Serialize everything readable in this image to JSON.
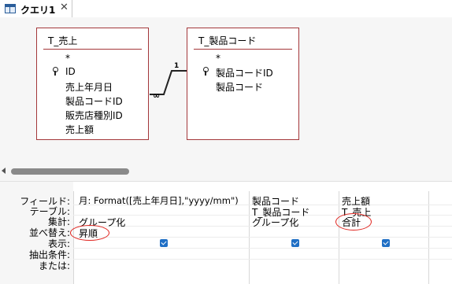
{
  "tab": {
    "label": "クエリ1",
    "close": "✕"
  },
  "tables": [
    {
      "title": "T_売上",
      "fields": [
        "*",
        "ID",
        "売上年月日",
        "製品コードID",
        "販売店種別ID",
        "売上額"
      ]
    },
    {
      "title": "T_製品コード",
      "fields": [
        "*",
        "製品コードID",
        "製品コード"
      ]
    }
  ],
  "relationship": {
    "one": "1",
    "many": "∞"
  },
  "grid": {
    "row_labels": [
      "フィールド:",
      "テーブル:",
      "集計:",
      "並べ替え:",
      "表示:",
      "抽出条件:",
      "または:"
    ],
    "columns": [
      {
        "field": "月: Format([売上年月日],\"yyyy/mm\")",
        "table": "",
        "total": "グループ化",
        "sort": "昇順",
        "show": true
      },
      {
        "field": "製品コード",
        "table": "T_製品コード",
        "total": "グループ化",
        "sort": "",
        "show": true
      },
      {
        "field": "売上額",
        "table": "T_売上",
        "total": "合計",
        "sort": "",
        "show": true
      }
    ]
  },
  "colors": {
    "table_border": "#a4373a",
    "check": "#1f6fc5",
    "highlight_ring": "#e0231d"
  }
}
